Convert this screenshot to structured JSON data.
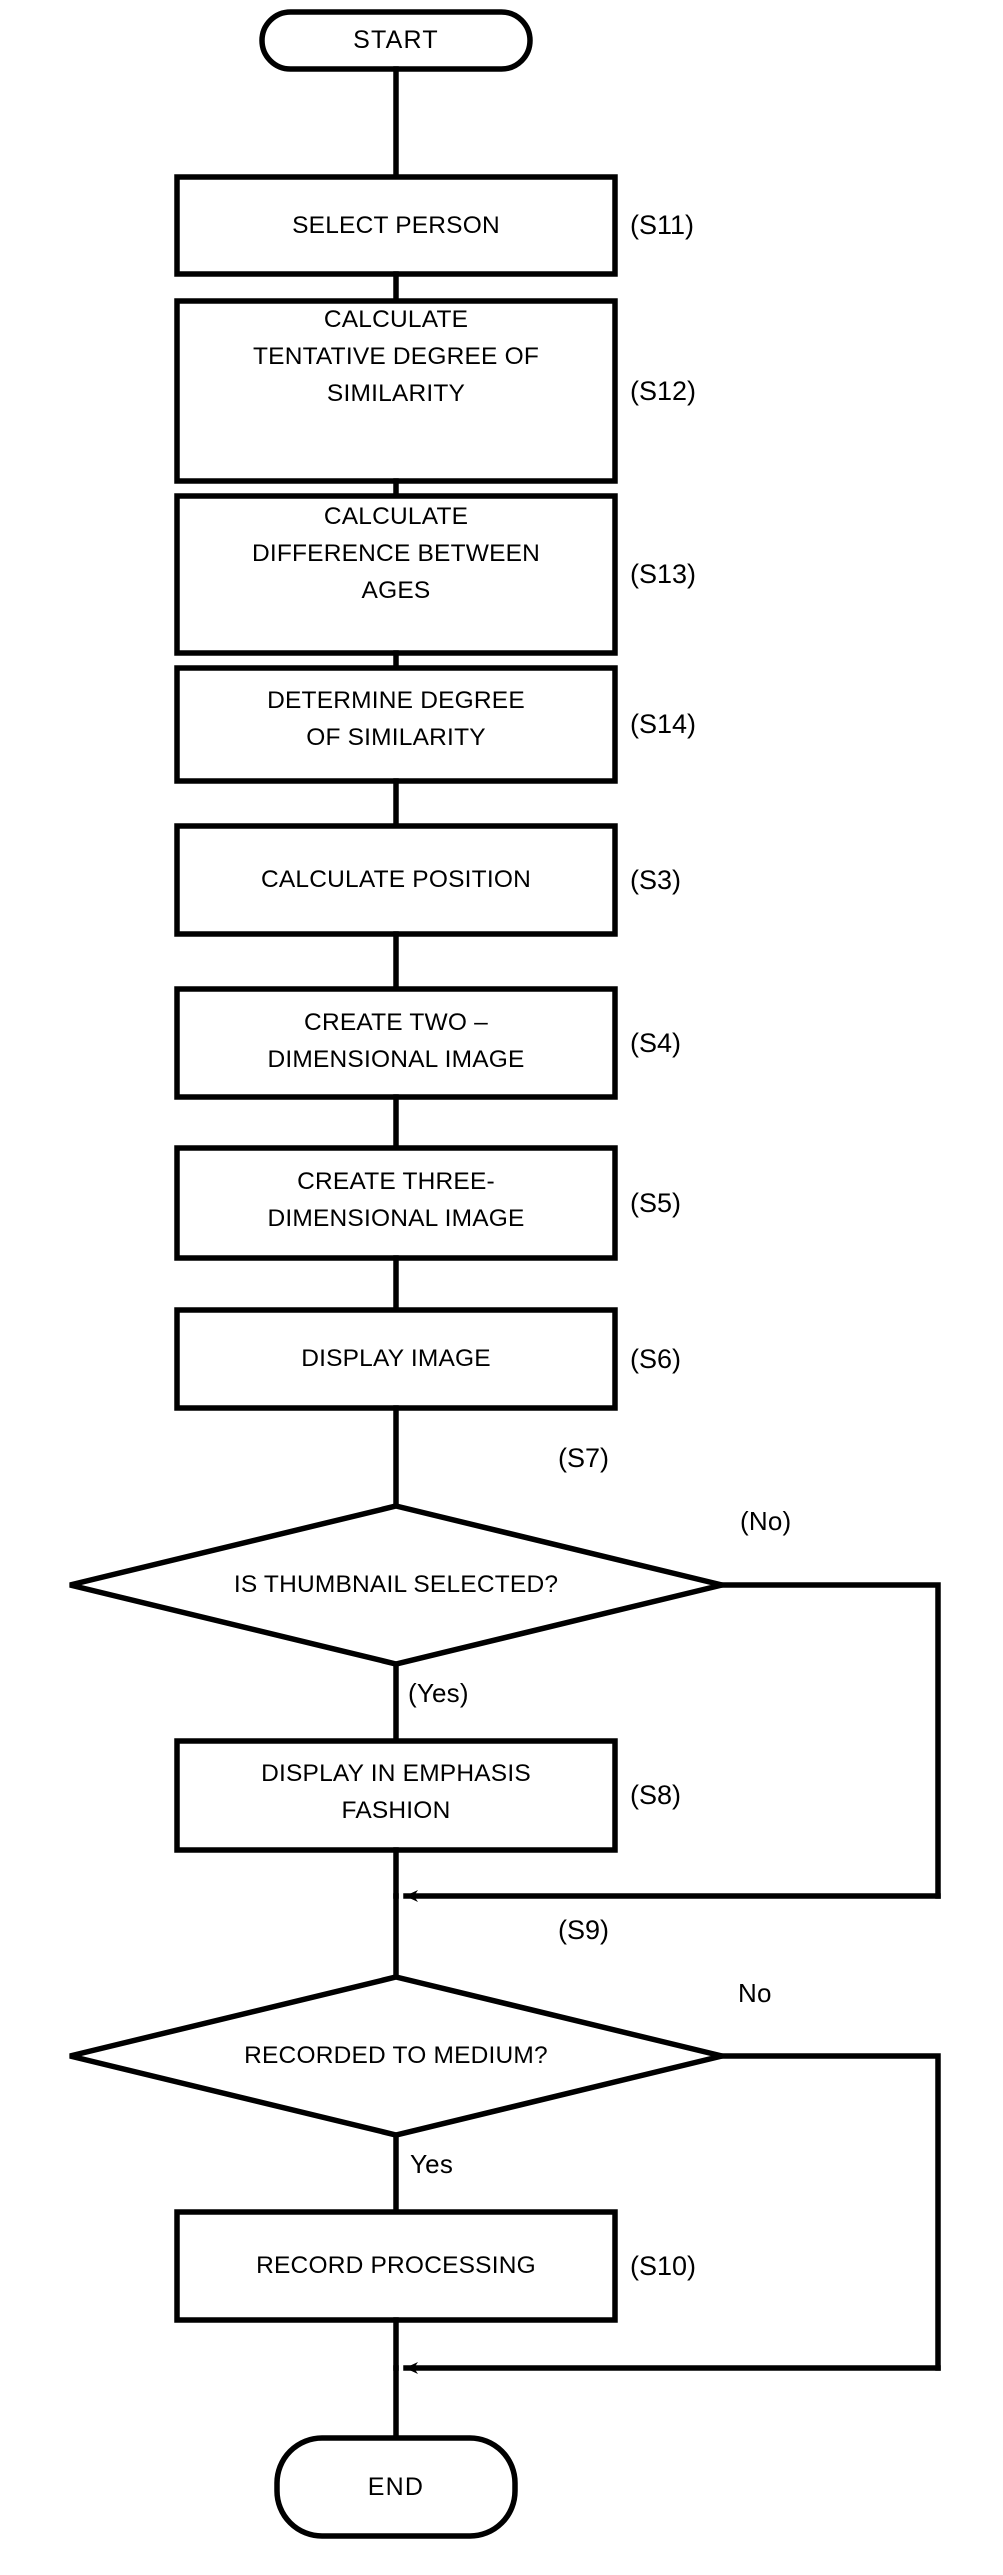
{
  "diagram": {
    "type": "flowchart",
    "title": "",
    "orientation": "vertical"
  },
  "terminators": {
    "start": "START",
    "end": "END"
  },
  "process_steps": [
    {
      "id": "S11",
      "label": "SELECT PERSON",
      "step_tag": "(S11)"
    },
    {
      "id": "S12",
      "label": "CALCULATE\nTENTATIVE DEGREE OF\nSIMILARITY",
      "step_tag": "(S12)"
    },
    {
      "id": "S13",
      "label": "CALCULATE\nDIFFERENCE BETWEEN\nAGES",
      "step_tag": "(S13)"
    },
    {
      "id": "S14",
      "label": "DETERMINE DEGREE\nOF SIMILARITY",
      "step_tag": "(S14)"
    },
    {
      "id": "S3",
      "label": "CALCULATE POSITION",
      "step_tag": "(S3)"
    },
    {
      "id": "S4",
      "label": "CREATE TWO –\nDIMENSIONAL IMAGE",
      "step_tag": "(S4)"
    },
    {
      "id": "S5",
      "label": "CREATE THREE-\nDIMENSIONAL IMAGE",
      "step_tag": "(S5)"
    },
    {
      "id": "S6",
      "label": "DISPLAY IMAGE",
      "step_tag": "(S6)"
    },
    {
      "id": "S8",
      "label": "DISPLAY IN EMPHASIS\nFASHION",
      "step_tag": "(S8)"
    },
    {
      "id": "S10",
      "label": "RECORD PROCESSING",
      "step_tag": "(S10)"
    }
  ],
  "decisions": [
    {
      "id": "S7",
      "label": "IS THUMBNAIL SELECTED?",
      "step_tag": "(S7)",
      "yes_label": "(Yes)",
      "no_label": "(No)"
    },
    {
      "id": "S9",
      "label": "RECORDED TO MEDIUM?",
      "step_tag": "(S9)",
      "yes_label": "Yes",
      "no_label": "No"
    }
  ],
  "lines": {
    "box_lines": {
      "s11": "SELECT PERSON",
      "s12_l1": "CALCULATE",
      "s12_l2": "TENTATIVE DEGREE OF",
      "s12_l3": "SIMILARITY",
      "s13_l1": "CALCULATE",
      "s13_l2": "DIFFERENCE BETWEEN",
      "s13_l3": "AGES",
      "s14_l1": "DETERMINE DEGREE",
      "s14_l2": "OF SIMILARITY",
      "s3": "CALCULATE POSITION",
      "s4_l1": "CREATE TWO –",
      "s4_l2": "DIMENSIONAL IMAGE",
      "s5_l1": "CREATE THREE-",
      "s5_l2": "DIMENSIONAL IMAGE",
      "s6": "DISPLAY IMAGE",
      "s8_l1": "DISPLAY IN EMPHASIS",
      "s8_l2": "FASHION",
      "s10": "RECORD PROCESSING"
    },
    "tags": {
      "s11": "(S11)",
      "s12": "(S12)",
      "s13": "(S13)",
      "s14": "(S14)",
      "s3": "(S3)",
      "s4": "(S4)",
      "s5": "(S5)",
      "s6": "(S6)",
      "s7": "(S7)",
      "s8": "(S8)",
      "s9": "(S9)",
      "s10": "(S10)"
    },
    "branches": {
      "s7_no": "(No)",
      "s7_yes": "(Yes)",
      "s9_no": "No",
      "s9_yes": "Yes"
    },
    "terminators": {
      "start": "START",
      "end": "END"
    },
    "decisions": {
      "s7": "IS THUMBNAIL SELECTED?",
      "s9": "RECORDED TO MEDIUM?"
    }
  },
  "colors": {
    "stroke": "#000000",
    "fill": "#ffffff"
  }
}
